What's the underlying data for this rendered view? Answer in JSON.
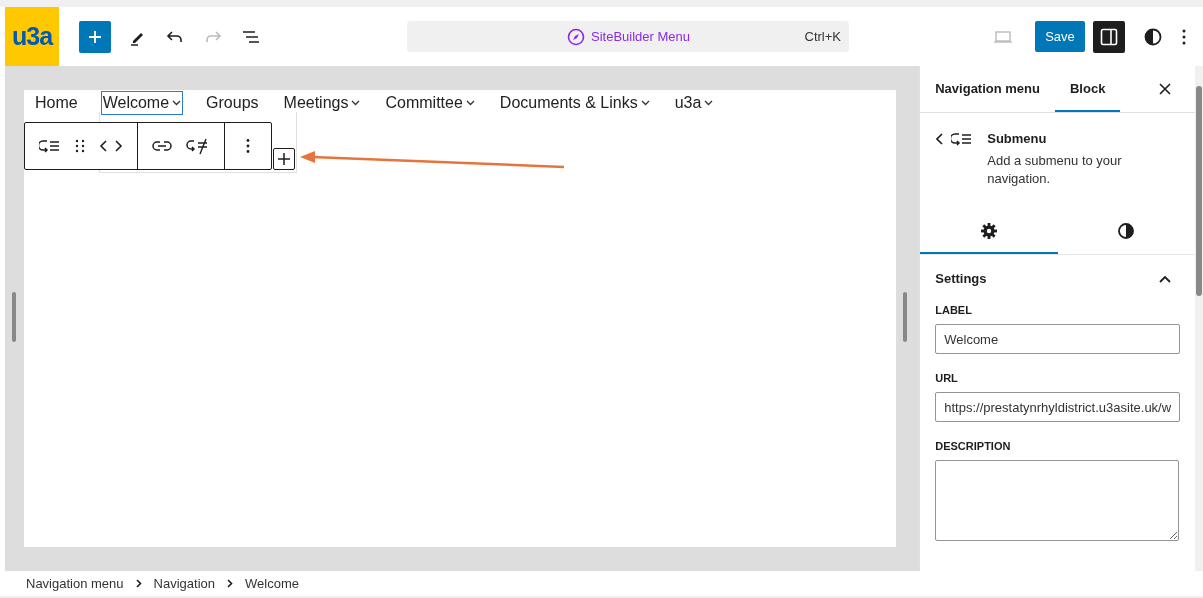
{
  "topbar": {
    "logo": "u3a",
    "command": {
      "label": "SiteBuilder Menu",
      "shortcut": "Ctrl+K"
    },
    "save": "Save",
    "settings_open": true
  },
  "nav": [
    {
      "label": "Home",
      "submenu": false,
      "selected": false
    },
    {
      "label": "Welcome",
      "submenu": true,
      "selected": true
    },
    {
      "label": "Groups",
      "submenu": false,
      "selected": false
    },
    {
      "label": "Meetings",
      "submenu": true,
      "selected": false
    },
    {
      "label": "Committee",
      "submenu": true,
      "selected": false
    },
    {
      "label": "Documents & Links",
      "submenu": true,
      "selected": false
    },
    {
      "label": "u3a",
      "submenu": true,
      "selected": false
    }
  ],
  "sidebar": {
    "tabs": [
      {
        "label": "Navigation menu",
        "selected": false
      },
      {
        "label": "Block",
        "selected": true
      }
    ],
    "block": {
      "title": "Submenu",
      "description": "Add a submenu to your navigation."
    },
    "inspector_tabs": [
      {
        "kind": "settings",
        "selected": true
      },
      {
        "kind": "styles",
        "selected": false
      }
    ],
    "panel": {
      "title": "Settings",
      "expanded": true
    },
    "fields": [
      {
        "label": "LABEL",
        "kind": "input",
        "value": "Welcome"
      },
      {
        "label": "URL",
        "kind": "input",
        "value": "https://prestatynrhyldistrict.u3asite.uk/w"
      },
      {
        "label": "DESCRIPTION",
        "kind": "textarea"
      }
    ]
  },
  "breadcrumb": [
    "Navigation menu",
    "Navigation",
    "Welcome"
  ]
}
